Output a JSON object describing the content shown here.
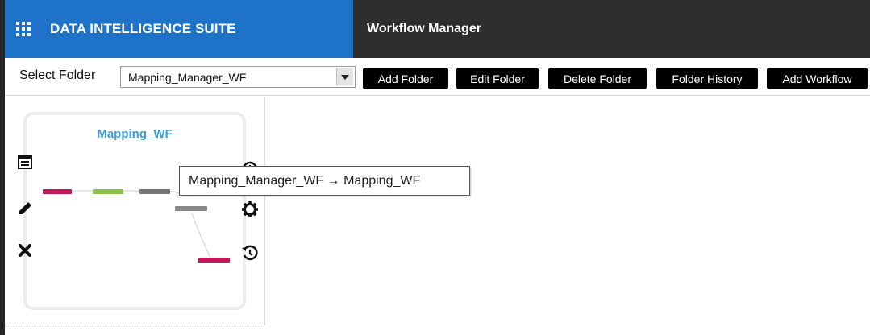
{
  "header": {
    "brand_title": "DATA INTELLIGENCE SUITE",
    "module_title": "Workflow Manager",
    "brand_color": "#1e73c8",
    "module_color": "#2e2e2e"
  },
  "toolbar": {
    "select_label": "Select Folder",
    "selected_folder": "Mapping_Manager_WF",
    "buttons": {
      "add_folder": "Add Folder",
      "edit_folder": "Edit Folder",
      "delete_folder": "Delete Folder",
      "folder_history": "Folder History",
      "add_workflow": "Add Workflow"
    }
  },
  "workflow_card": {
    "title": "Mapping_WF",
    "title_color": "#3b9fd6",
    "actions": [
      "details-icon",
      "edit-icon",
      "delete-icon",
      "info-icon",
      "settings-icon",
      "history-icon"
    ],
    "node_colors": {
      "start": "#c2185b",
      "mapping": "#8bc34a",
      "session": "#757575",
      "end": "#c2185b"
    }
  },
  "tooltip": {
    "text": "Mapping_Manager_WF → Mapping_WF"
  }
}
